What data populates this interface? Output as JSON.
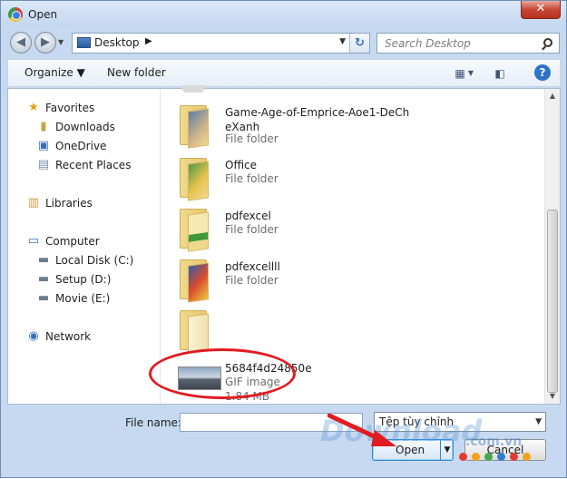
{
  "window": {
    "title": "Open"
  },
  "nav": {
    "address_location": "Desktop",
    "search_placeholder": "Search Desktop"
  },
  "toolbar": {
    "organize_label": "Organize",
    "new_folder_label": "New folder"
  },
  "sidebar": {
    "items": [
      {
        "label": "Favorites",
        "icon": "star-icon"
      },
      {
        "label": "Downloads",
        "icon": "downloads-folder-icon"
      },
      {
        "label": "OneDrive",
        "icon": "onedrive-icon"
      },
      {
        "label": "Recent Places",
        "icon": "recent-places-icon"
      },
      {
        "label": "Libraries",
        "icon": "libraries-icon"
      },
      {
        "label": "Computer",
        "icon": "computer-icon"
      },
      {
        "label": "Local Disk (C:)",
        "icon": "drive-icon"
      },
      {
        "label": "Setup (D:)",
        "icon": "drive-icon"
      },
      {
        "label": "Movie  (E:)",
        "icon": "drive-icon"
      },
      {
        "label": "Network",
        "icon": "network-icon"
      }
    ]
  },
  "files": [
    {
      "name_line1": "Game-Age-of-Emprice-Aoe1-DeCh",
      "name_line2": "eXanh",
      "type": "File folder"
    },
    {
      "name_line1": "Office",
      "type": "File folder"
    },
    {
      "name_line1": "pdfexcel",
      "type": "File folder"
    },
    {
      "name_line1": "pdfexcellll",
      "type": "File folder"
    },
    {
      "name_line1": "",
      "type": ""
    },
    {
      "name_line1": "5684f4d24850e",
      "type": "GIF image",
      "size": "1.84 MB"
    }
  ],
  "bottom": {
    "file_name_label": "File name:",
    "file_name_value": "",
    "file_type": "Tệp tùy chỉnh",
    "open_label": "Open",
    "cancel_label": "Cancel"
  },
  "watermark": {
    "brand": "Download",
    "domain": ".com.vn"
  },
  "colors": {
    "annotation_red": "#e11b22",
    "accent_blue": "#2e8ad6"
  }
}
